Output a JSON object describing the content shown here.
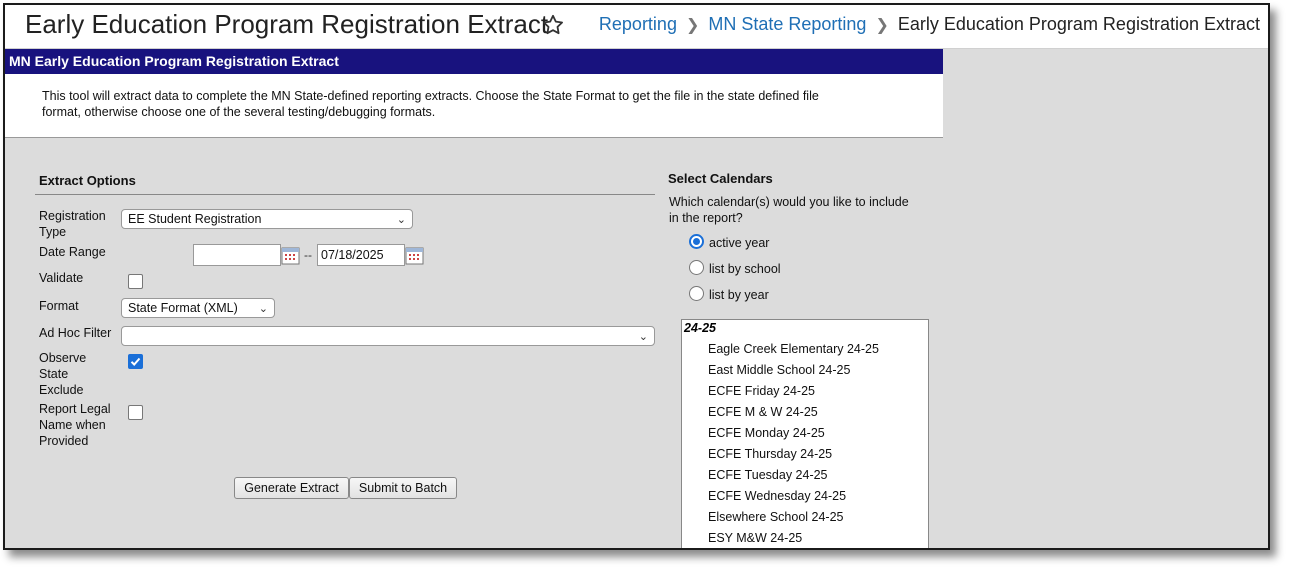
{
  "header": {
    "title": "Early Education Program Registration Extract",
    "breadcrumb": [
      "Reporting",
      "MN State Reporting",
      "Early Education Program Registration Extract"
    ]
  },
  "panel": {
    "title": "MN Early Education Program Registration Extract",
    "description_line1": "This tool will extract data to complete the MN State-defined reporting extracts. Choose the State Format to get the file in the state defined file",
    "description_line2": "format, otherwise choose one of the several testing/debugging formats."
  },
  "extract_options": {
    "title": "Extract Options",
    "registration_type": {
      "label_line1": "Registration",
      "label_line2": "Type",
      "value": "EE Student Registration"
    },
    "date_range": {
      "label": "Date Range",
      "start": "",
      "separator": "--",
      "end": "07/18/2025"
    },
    "validate": {
      "label": "Validate",
      "checked": false
    },
    "format": {
      "label": "Format",
      "value": "State Format (XML)"
    },
    "ad_hoc_filter": {
      "label": "Ad Hoc Filter",
      "value": ""
    },
    "observe_state_exclude": {
      "label_line1": "Observe",
      "label_line2": "State",
      "label_line3": "Exclude",
      "checked": true
    },
    "report_legal_name": {
      "label_line1": "Report Legal",
      "label_line2": "Name when",
      "label_line3": "Provided",
      "checked": false
    }
  },
  "buttons": {
    "generate": "Generate Extract",
    "submit_batch": "Submit to Batch"
  },
  "calendars": {
    "title": "Select Calendars",
    "question_line1": "Which calendar(s) would you like to include",
    "question_line2": "in the report?",
    "options": [
      {
        "label": "active year",
        "checked": true
      },
      {
        "label": "list by school",
        "checked": false
      },
      {
        "label": "list by year",
        "checked": false
      }
    ],
    "group": "24-25",
    "items": [
      "Eagle Creek Elementary 24-25",
      "East Middle School 24-25",
      "ECFE Friday 24-25",
      "ECFE M & W 24-25",
      "ECFE Monday 24-25",
      "ECFE Thursday 24-25",
      "ECFE Tuesday 24-25",
      "ECFE Wednesday 24-25",
      "Elsewhere School 24-25",
      "ESY M&W 24-25"
    ]
  },
  "colors": {
    "header_bar": "#18127e",
    "link": "#1f6fb5",
    "accent": "#1a6fd8",
    "background": "#dcdcdc"
  }
}
